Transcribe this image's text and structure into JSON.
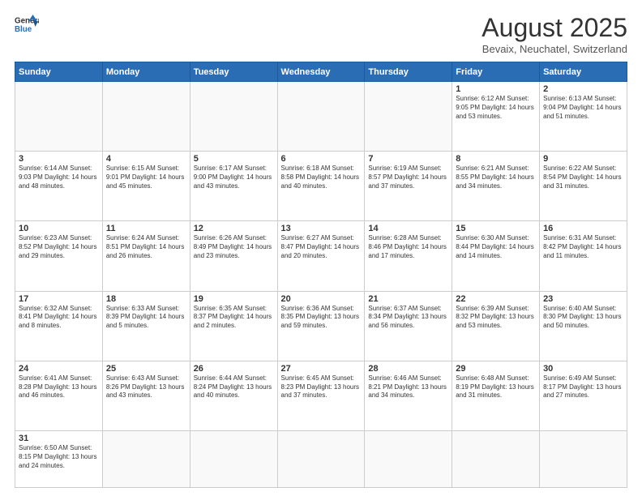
{
  "header": {
    "logo_general": "General",
    "logo_blue": "Blue",
    "month_year": "August 2025",
    "location": "Bevaix, Neuchatel, Switzerland"
  },
  "weekdays": [
    "Sunday",
    "Monday",
    "Tuesday",
    "Wednesday",
    "Thursday",
    "Friday",
    "Saturday"
  ],
  "weeks": [
    [
      {
        "day": "",
        "info": ""
      },
      {
        "day": "",
        "info": ""
      },
      {
        "day": "",
        "info": ""
      },
      {
        "day": "",
        "info": ""
      },
      {
        "day": "",
        "info": ""
      },
      {
        "day": "1",
        "info": "Sunrise: 6:12 AM\nSunset: 9:05 PM\nDaylight: 14 hours and 53 minutes."
      },
      {
        "day": "2",
        "info": "Sunrise: 6:13 AM\nSunset: 9:04 PM\nDaylight: 14 hours and 51 minutes."
      }
    ],
    [
      {
        "day": "3",
        "info": "Sunrise: 6:14 AM\nSunset: 9:03 PM\nDaylight: 14 hours and 48 minutes."
      },
      {
        "day": "4",
        "info": "Sunrise: 6:15 AM\nSunset: 9:01 PM\nDaylight: 14 hours and 45 minutes."
      },
      {
        "day": "5",
        "info": "Sunrise: 6:17 AM\nSunset: 9:00 PM\nDaylight: 14 hours and 43 minutes."
      },
      {
        "day": "6",
        "info": "Sunrise: 6:18 AM\nSunset: 8:58 PM\nDaylight: 14 hours and 40 minutes."
      },
      {
        "day": "7",
        "info": "Sunrise: 6:19 AM\nSunset: 8:57 PM\nDaylight: 14 hours and 37 minutes."
      },
      {
        "day": "8",
        "info": "Sunrise: 6:21 AM\nSunset: 8:55 PM\nDaylight: 14 hours and 34 minutes."
      },
      {
        "day": "9",
        "info": "Sunrise: 6:22 AM\nSunset: 8:54 PM\nDaylight: 14 hours and 31 minutes."
      }
    ],
    [
      {
        "day": "10",
        "info": "Sunrise: 6:23 AM\nSunset: 8:52 PM\nDaylight: 14 hours and 29 minutes."
      },
      {
        "day": "11",
        "info": "Sunrise: 6:24 AM\nSunset: 8:51 PM\nDaylight: 14 hours and 26 minutes."
      },
      {
        "day": "12",
        "info": "Sunrise: 6:26 AM\nSunset: 8:49 PM\nDaylight: 14 hours and 23 minutes."
      },
      {
        "day": "13",
        "info": "Sunrise: 6:27 AM\nSunset: 8:47 PM\nDaylight: 14 hours and 20 minutes."
      },
      {
        "day": "14",
        "info": "Sunrise: 6:28 AM\nSunset: 8:46 PM\nDaylight: 14 hours and 17 minutes."
      },
      {
        "day": "15",
        "info": "Sunrise: 6:30 AM\nSunset: 8:44 PM\nDaylight: 14 hours and 14 minutes."
      },
      {
        "day": "16",
        "info": "Sunrise: 6:31 AM\nSunset: 8:42 PM\nDaylight: 14 hours and 11 minutes."
      }
    ],
    [
      {
        "day": "17",
        "info": "Sunrise: 6:32 AM\nSunset: 8:41 PM\nDaylight: 14 hours and 8 minutes."
      },
      {
        "day": "18",
        "info": "Sunrise: 6:33 AM\nSunset: 8:39 PM\nDaylight: 14 hours and 5 minutes."
      },
      {
        "day": "19",
        "info": "Sunrise: 6:35 AM\nSunset: 8:37 PM\nDaylight: 14 hours and 2 minutes."
      },
      {
        "day": "20",
        "info": "Sunrise: 6:36 AM\nSunset: 8:35 PM\nDaylight: 13 hours and 59 minutes."
      },
      {
        "day": "21",
        "info": "Sunrise: 6:37 AM\nSunset: 8:34 PM\nDaylight: 13 hours and 56 minutes."
      },
      {
        "day": "22",
        "info": "Sunrise: 6:39 AM\nSunset: 8:32 PM\nDaylight: 13 hours and 53 minutes."
      },
      {
        "day": "23",
        "info": "Sunrise: 6:40 AM\nSunset: 8:30 PM\nDaylight: 13 hours and 50 minutes."
      }
    ],
    [
      {
        "day": "24",
        "info": "Sunrise: 6:41 AM\nSunset: 8:28 PM\nDaylight: 13 hours and 46 minutes."
      },
      {
        "day": "25",
        "info": "Sunrise: 6:43 AM\nSunset: 8:26 PM\nDaylight: 13 hours and 43 minutes."
      },
      {
        "day": "26",
        "info": "Sunrise: 6:44 AM\nSunset: 8:24 PM\nDaylight: 13 hours and 40 minutes."
      },
      {
        "day": "27",
        "info": "Sunrise: 6:45 AM\nSunset: 8:23 PM\nDaylight: 13 hours and 37 minutes."
      },
      {
        "day": "28",
        "info": "Sunrise: 6:46 AM\nSunset: 8:21 PM\nDaylight: 13 hours and 34 minutes."
      },
      {
        "day": "29",
        "info": "Sunrise: 6:48 AM\nSunset: 8:19 PM\nDaylight: 13 hours and 31 minutes."
      },
      {
        "day": "30",
        "info": "Sunrise: 6:49 AM\nSunset: 8:17 PM\nDaylight: 13 hours and 27 minutes."
      }
    ],
    [
      {
        "day": "31",
        "info": "Sunrise: 6:50 AM\nSunset: 8:15 PM\nDaylight: 13 hours and 24 minutes."
      },
      {
        "day": "",
        "info": ""
      },
      {
        "day": "",
        "info": ""
      },
      {
        "day": "",
        "info": ""
      },
      {
        "day": "",
        "info": ""
      },
      {
        "day": "",
        "info": ""
      },
      {
        "day": "",
        "info": ""
      }
    ]
  ]
}
